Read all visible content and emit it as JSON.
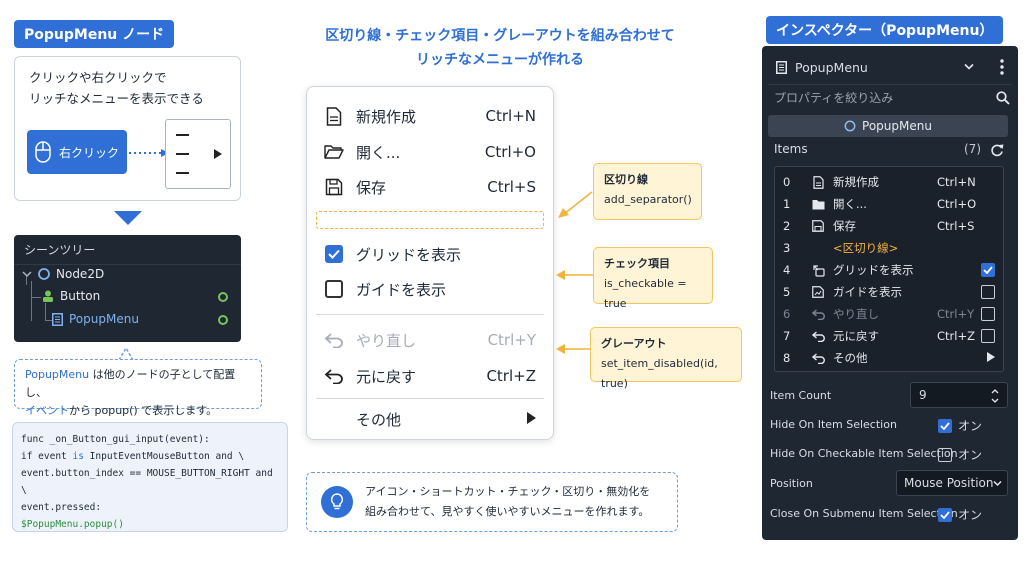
{
  "left": {
    "tag": "PopupMenu ノード",
    "desc_line1": "クリックや右クリックで",
    "desc_line2": "リッチなメニューを表示できる",
    "right_click_label": "右クリック",
    "scene_tree": {
      "title": "シーンツリー",
      "nodes": [
        "Node2D",
        "Button",
        "PopupMenu"
      ]
    },
    "note": {
      "l1_a": "PopupMenu",
      "l1_b": " は他のノードの子として配置し、",
      "l2_a": "イベント",
      "l2_b": "から popup() で表示します。"
    },
    "code": {
      "line1": "func _on_Button_gui_input(event):",
      "line2_a": " if event ",
      "line2_kw": "is",
      "line2_b": " InputEventMouseButton and \\",
      "line3": "  event.button_index == MOUSE_BUTTON_RIGHT and \\",
      "line4": "  event.pressed:",
      "line5": "   $PopupMenu.popup()"
    }
  },
  "middle": {
    "headline1": "区切り線・チェック項目・グレーアウトを組み合わせて",
    "headline2": "リッチなメニューが作れる",
    "menu": {
      "new_label": "新規作成",
      "new_shortcut": "Ctrl+N",
      "open_label": "開く...",
      "open_shortcut": "Ctrl+O",
      "save_label": "保存",
      "save_shortcut": "Ctrl+S",
      "grid_label": "グリッドを表示",
      "guide_label": "ガイドを表示",
      "redo_label": "やり直し",
      "redo_shortcut": "Ctrl+Y",
      "undo_label": "元に戻す",
      "undo_shortcut": "Ctrl+Z",
      "other_label": "その他"
    },
    "callouts": {
      "sep_title": "区切り線",
      "sep_code": "add_separator()",
      "check_title": "チェック項目",
      "check_code": "is_checkable = true",
      "gray_title": "グレーアウト",
      "gray_code": "set_item_disabled(id, true)"
    },
    "tip_line1": "アイコン・ショートカット・チェック・区切り・無効化を",
    "tip_line2": "組み合わせて、見やすく使いやすいメニューを作れます。"
  },
  "inspector": {
    "tag": "インスペクター（PopupMenu）",
    "node_type": "PopupMenu",
    "filter_placeholder": "プロパティを絞り込み",
    "node_button": "PopupMenu",
    "items_label": "Items",
    "items_count": "(7)",
    "items": [
      {
        "idx": "0",
        "label": "新規作成",
        "shortcut": "Ctrl+N"
      },
      {
        "idx": "1",
        "label": "開く...",
        "shortcut": "Ctrl+O"
      },
      {
        "idx": "2",
        "label": "保存",
        "shortcut": "Ctrl+S"
      },
      {
        "idx": "3",
        "label": "<区切り線>",
        "shortcut": ""
      },
      {
        "idx": "4",
        "label": "グリッドを表示",
        "shortcut": ""
      },
      {
        "idx": "5",
        "label": "ガイドを表示",
        "shortcut": ""
      },
      {
        "idx": "6",
        "label": "やり直し",
        "shortcut": "Ctrl+Y"
      },
      {
        "idx": "7",
        "label": "元に戻す",
        "shortcut": "Ctrl+Z"
      },
      {
        "idx": "8",
        "label": "その他",
        "shortcut": ""
      }
    ],
    "item_count_label": "Item Count",
    "item_count_value": "9",
    "hide_on_item_label": "Hide On Item Selection",
    "hide_on_checkable_label": "Hide On Checkable Item Selection",
    "position_label": "Position",
    "position_value": "Mouse Position",
    "close_on_submenu_label": "Close On Submenu Item Selection",
    "on_text": "オン"
  },
  "colors": {
    "accent": "#2f6fd6",
    "panel": "#1f2733",
    "callout": "#fff5d6",
    "separator": "#f2b43a"
  }
}
